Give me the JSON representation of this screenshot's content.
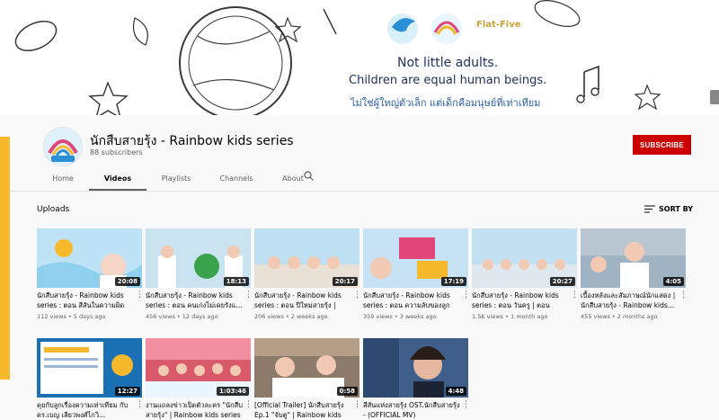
{
  "banner": {
    "line1": "Not little adults.",
    "line2": "Children are equal human beings.",
    "line3": "ไม่ใช่ผู้ใหญ่ตัวเล็ก แต่เด็กคือมนุษย์ที่เท่าเทียม",
    "logo_flat": "Flat-Five"
  },
  "channel": {
    "name": "นักสืบสายรุ้ง - Rainbow kids series",
    "subscribers": "88 subscribers",
    "subscribe_label": "SUBSCRIBE"
  },
  "tabs": [
    {
      "label": "Home"
    },
    {
      "label": "Videos"
    },
    {
      "label": "Playlists"
    },
    {
      "label": "Channels"
    },
    {
      "label": "About"
    }
  ],
  "uploads": {
    "label": "Uploads",
    "sort_label": "SORT BY"
  },
  "videos": [
    {
      "title": "นักสืบสายรุ้ง - Rainbow kids series : ตอน สีสันในความผิด |...",
      "meta": "112 views • 5 days ago",
      "duration": "20:08",
      "bg": "#bfe3f6"
    },
    {
      "title": "นักสืบสายรุ้ง - Rainbow kids series : ตอน คนเก่งไม่เคยรังแ...",
      "meta": "456 views • 12 days ago",
      "duration": "18:13",
      "bg": "#c9e4f0"
    },
    {
      "title": "นักสืบสายรุ้ง - Rainbow kids series : ตอน ปีใหม่สายรุ้ง | ตอ...",
      "meta": "206 views • 2 weeks ago",
      "duration": "20:17",
      "bg": "#bfe0f2"
    },
    {
      "title": "นักสืบสายรุ้ง - Rainbow kids series : ตอน ความลับของลูกพ...",
      "meta": "359 views • 3 weeks ago",
      "duration": "17:19",
      "bg": "#c6e2f4"
    },
    {
      "title": "นักสืบสายรุ้ง - Rainbow kids series : ตอน วันครู | ตอน ผลัด...",
      "meta": "1.5K views • 1 month ago",
      "duration": "20:27",
      "bg": "#c2e1f3"
    },
    {
      "title": "เบื้องหลังและสัมภาษณ์นักแสดง | นักสืบสายรุ้ง - Rainbow kids...",
      "meta": "455 views • 2 months ago",
      "duration": "4:05",
      "bg": "#9fb3c2"
    },
    {
      "title": "คุยกับลูกเรื่องความเท่าเทียม กับ ดร.เบญ เลียวพงศ์ไกวิ...",
      "meta": "",
      "duration": "12:27",
      "bg": "#1b6fb3"
    },
    {
      "title": "งานแถลงข่าวเปิดตัวละคร \"นักสืบสายรุ้ง\" | Rainbow kids series",
      "meta": "",
      "duration": "1:03:46",
      "bg": "#d95a6a"
    },
    {
      "title": "[Official Trailer] นักสืบสายรุ้ง Ep.1 \"จับตู\" | Rainbow kids",
      "meta": "",
      "duration": "0:58",
      "bg": "#8c7a6b"
    },
    {
      "title": "สีสันแห่งสายรุ้ง OST.นักสืบสายรุ้ง - (OFFICIAL MV)",
      "meta": "",
      "duration": "4:48",
      "bg": "#3f5f8a"
    }
  ],
  "colors": {
    "subscribe": "#cc0000",
    "accent": "#f7b92c",
    "duration_bg": "#000000"
  }
}
